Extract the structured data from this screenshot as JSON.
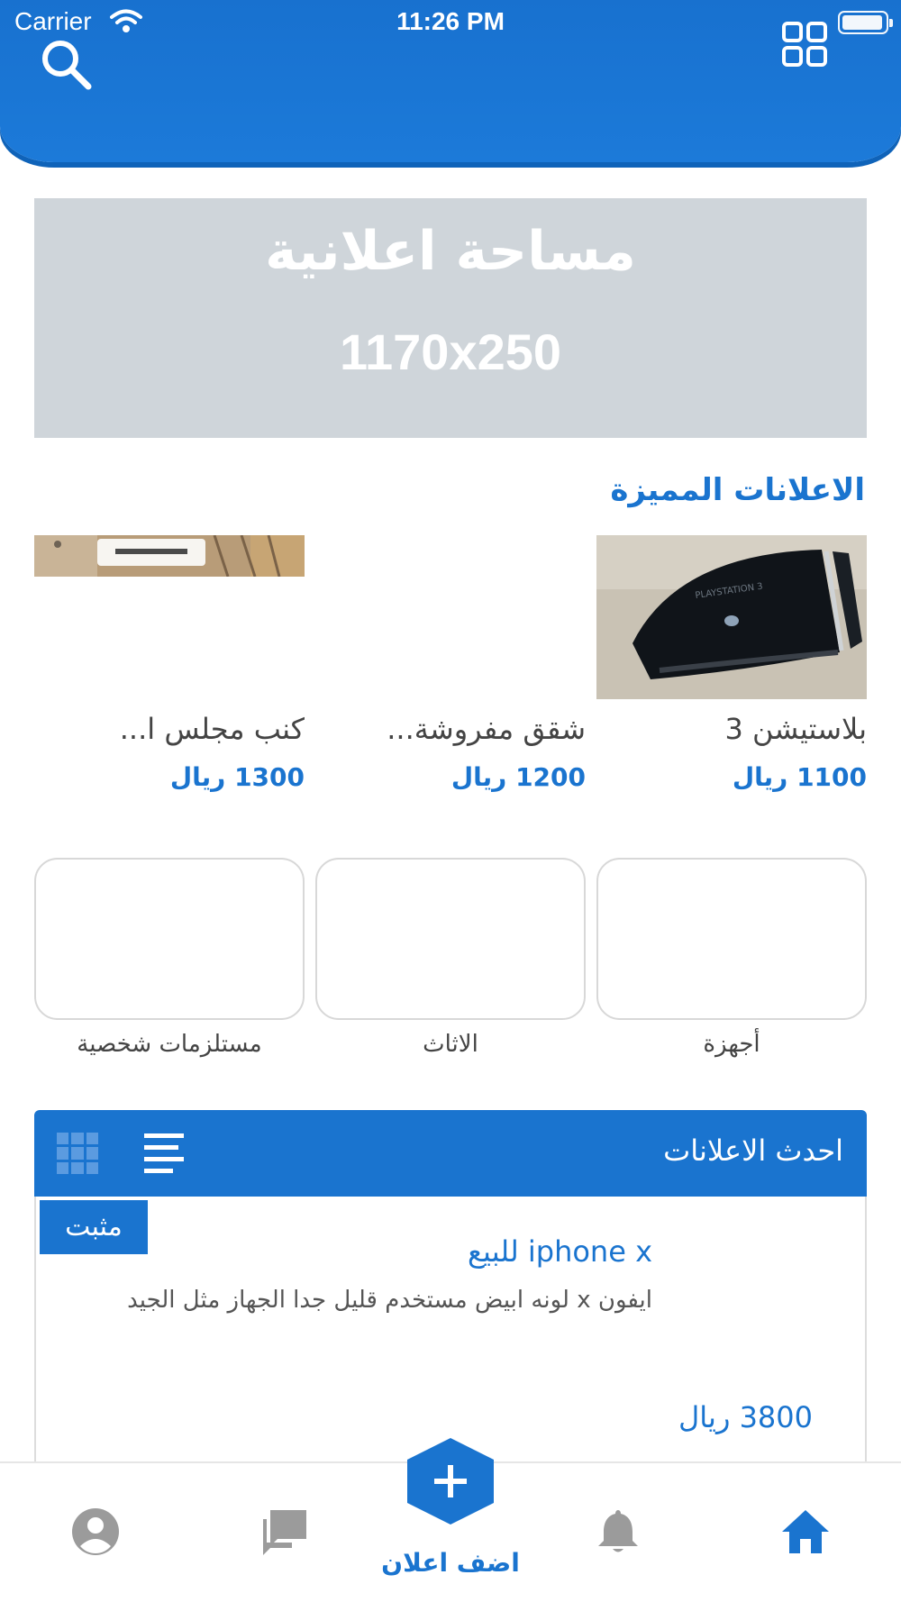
{
  "status_bar": {
    "carrier": "Carrier",
    "time": "11:26 PM"
  },
  "header": {
    "search_icon": "search-icon",
    "menu_icon": "grid-menu-icon"
  },
  "ad_banner": {
    "title": "مساحة اعلانية",
    "size": "1170x250"
  },
  "featured": {
    "title": "الاعلانات المميزة",
    "items": [
      {
        "name": "بلاستيشن 3",
        "price": "1100 ريال"
      },
      {
        "name": "شقق مفروشة...",
        "price": "1200 ريال"
      },
      {
        "name": "كنب مجلس ا...",
        "price": "1300 ريال"
      }
    ]
  },
  "categories": [
    {
      "label": "أجهزة"
    },
    {
      "label": "الاثاث"
    },
    {
      "label": "مستلزمات شخصية"
    }
  ],
  "latest": {
    "title": "احدث الاعلانات",
    "listing": {
      "badge": "مثبت",
      "title": "iphone x للبيع",
      "description": "ايفون x لونه ابيض مستخدم قليل جدا الجهاز مثل الجيد",
      "price": "3800 ريال"
    }
  },
  "bottom_nav": {
    "add_label": "اضف اعلان",
    "items": [
      "home-icon",
      "bell-icon",
      "chat-icon",
      "profile-icon"
    ]
  },
  "colors": {
    "primary": "#1a74cf",
    "banner_gray": "#cfd5da",
    "icon_gray": "#9b9b9b"
  }
}
